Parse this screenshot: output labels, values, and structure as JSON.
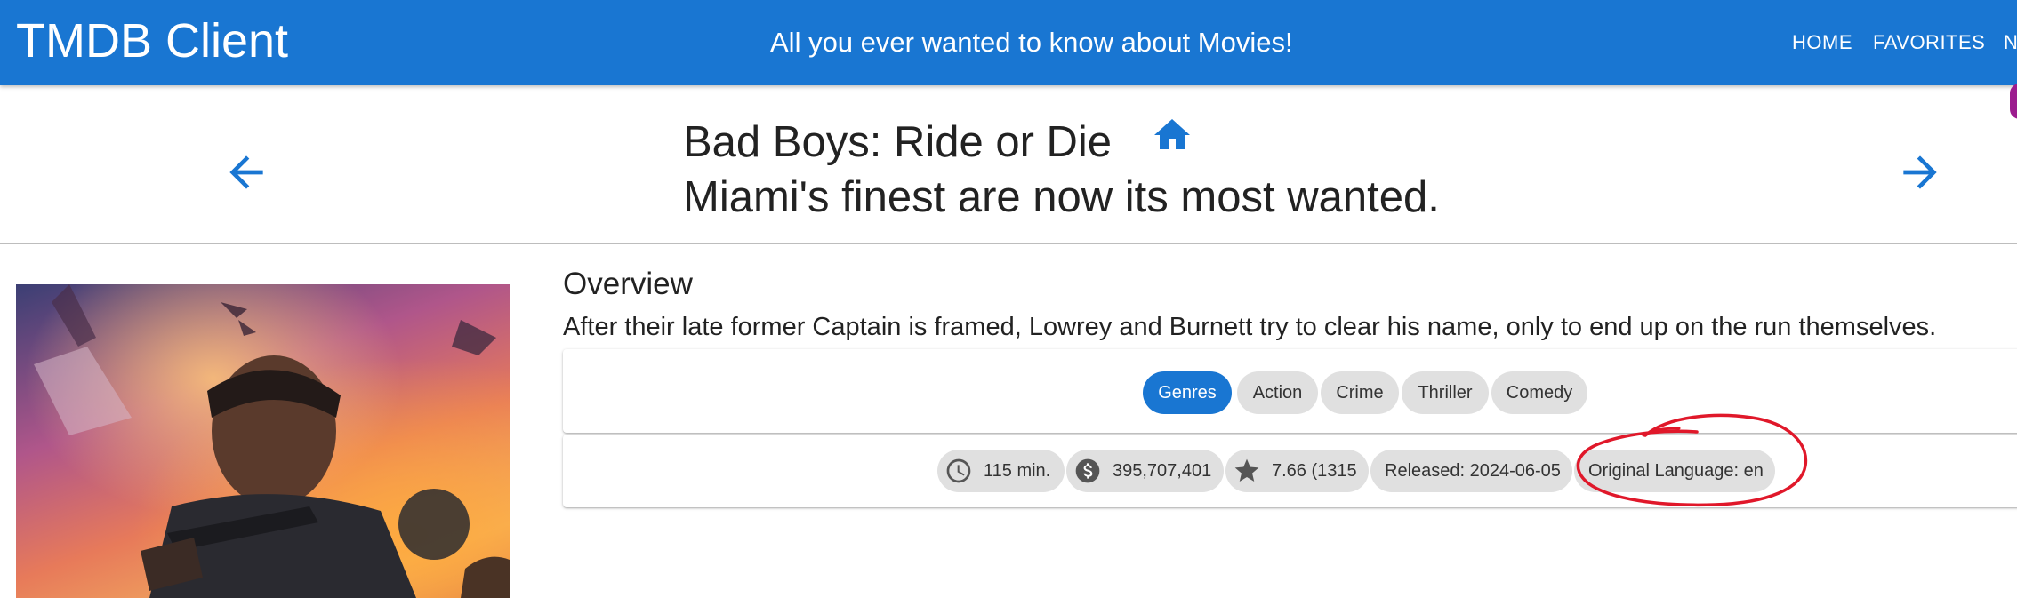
{
  "app": {
    "title": "TMDB Client",
    "tagline": "All you ever wanted to know about Movies!",
    "nav": [
      "HOME",
      "FAVORITES",
      "N"
    ]
  },
  "movie": {
    "title": "Bad Boys: Ride or Die",
    "tagline": "Miami's finest are now its most wanted."
  },
  "overview": {
    "heading": "Overview",
    "text": "After their late former Captain is framed, Lowrey and Burnett try to clear his name, only to end up on the run themselves."
  },
  "genres": {
    "label": "Genres",
    "items": [
      "Action",
      "Crime",
      "Thriller",
      "Comedy"
    ]
  },
  "facts": {
    "runtime": "115 min.",
    "revenue": "395,707,401",
    "rating": "7.66 (1315",
    "released": "Released: 2024-06-05",
    "language": "Original Language: en"
  },
  "icons": {
    "back": "arrow-back-icon",
    "forward": "arrow-forward-icon",
    "home": "home-icon",
    "runtime": "clock-icon",
    "revenue": "dollar-icon",
    "rating": "star-icon"
  },
  "colors": {
    "primary": "#1976d2",
    "chip": "#e0e0e0",
    "annotation": "#e0182a"
  }
}
